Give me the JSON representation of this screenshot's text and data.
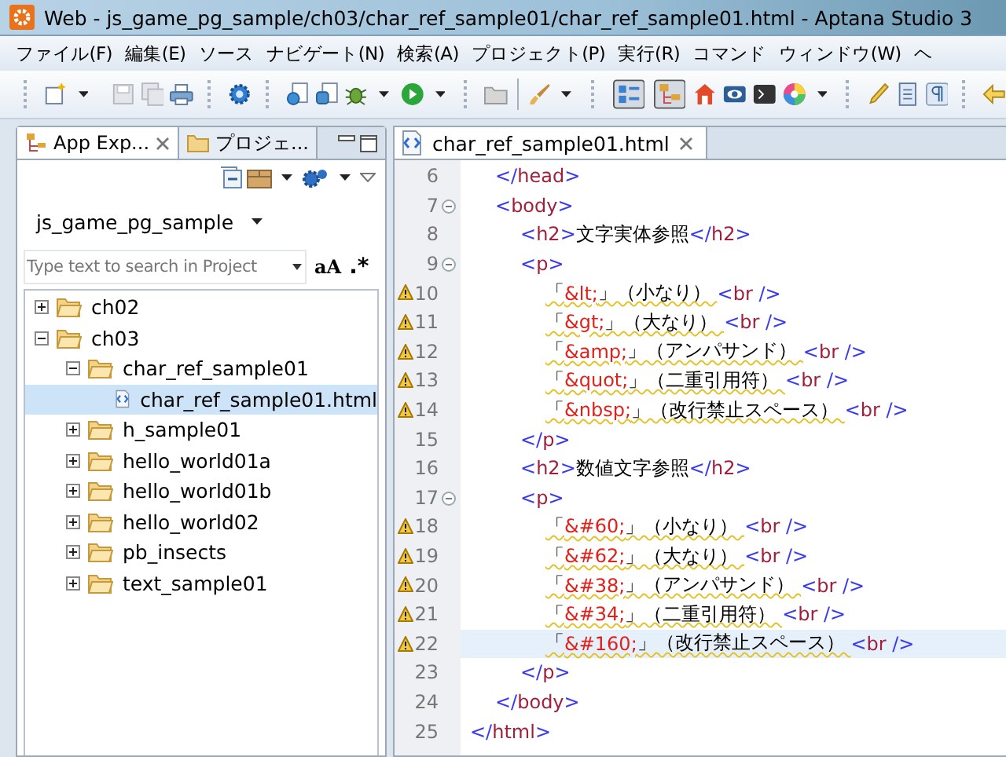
{
  "window": {
    "title": "Web - js_game_pg_sample/ch03/char_ref_sample01/char_ref_sample01.html - Aptana Studio 3"
  },
  "menu": [
    "ファイル(F)",
    "編集(E)",
    "ソース",
    "ナビゲート(N)",
    "検索(A)",
    "プロジェクト(P)",
    "実行(R)",
    "コマンド",
    "ウィンドウ(W)",
    "ヘ"
  ],
  "left_panel": {
    "tabs": [
      {
        "label": "App Exp...",
        "selected": true
      },
      {
        "label": "プロジェ...",
        "selected": false
      }
    ],
    "project": "js_game_pg_sample",
    "search": {
      "placeholder": "Type text to search in Project",
      "case_toggle": "aA",
      "regex_toggle": ".*"
    },
    "tree": [
      {
        "label": "ch02",
        "kind": "folder",
        "expanded": false,
        "selected": false
      },
      {
        "label": "ch03",
        "kind": "folder",
        "expanded": true,
        "selected": false,
        "children": [
          {
            "label": "char_ref_sample01",
            "kind": "folder",
            "expanded": true,
            "selected": false,
            "children": [
              {
                "label": "char_ref_sample01.html",
                "kind": "file",
                "selected": true
              }
            ]
          },
          {
            "label": "h_sample01",
            "kind": "folder",
            "expanded": false,
            "selected": false
          },
          {
            "label": "hello_world01a",
            "kind": "folder",
            "expanded": false,
            "selected": false
          },
          {
            "label": "hello_world01b",
            "kind": "folder",
            "expanded": false,
            "selected": false
          },
          {
            "label": "hello_world02",
            "kind": "folder",
            "expanded": false,
            "selected": false
          },
          {
            "label": "pb_insects",
            "kind": "folder",
            "expanded": false,
            "selected": false
          },
          {
            "label": "text_sample01",
            "kind": "folder",
            "expanded": false,
            "selected": false
          }
        ]
      }
    ]
  },
  "editor": {
    "tab": {
      "label": "char_ref_sample01.html",
      "selected": true
    },
    "lines": [
      {
        "children": [
          {
            "n": "6",
            "warning": false,
            "foldable": false,
            "current": false,
            "tokens": [
              {
                "kind": "punct",
                "text": "</"
              },
              {
                "kind": "tag",
                "text": "head"
              },
              {
                "kind": "punct",
                "text": ">"
              }
            ]
          },
          {
            "n": "7",
            "warning": false,
            "foldable": true,
            "current": false,
            "tokens": [
              {
                "kind": "punct",
                "text": "<"
              },
              {
                "kind": "tag",
                "text": "body"
              },
              {
                "kind": "punct",
                "text": ">"
              }
            ],
            "children": [
              {
                "n": "8",
                "warning": false,
                "foldable": false,
                "current": false,
                "tokens": [
                  {
                    "kind": "punct",
                    "text": "<"
                  },
                  {
                    "kind": "tag",
                    "text": "h2"
                  },
                  {
                    "kind": "punct",
                    "text": ">"
                  },
                  {
                    "kind": "plain",
                    "text": "文字実体参照"
                  },
                  {
                    "kind": "punct",
                    "text": "</"
                  },
                  {
                    "kind": "tag",
                    "text": "h2"
                  },
                  {
                    "kind": "punct",
                    "text": ">"
                  }
                ]
              },
              {
                "n": "9",
                "warning": false,
                "foldable": true,
                "current": false,
                "tokens": [
                  {
                    "kind": "punct",
                    "text": "<"
                  },
                  {
                    "kind": "tag",
                    "text": "p"
                  },
                  {
                    "kind": "punct",
                    "text": ">"
                  }
                ],
                "children": [
                  {
                    "n": "10",
                    "warning": true,
                    "foldable": false,
                    "current": false,
                    "tokens": [
                      {
                        "kind": "plain",
                        "text": "「"
                      },
                      {
                        "kind": "entity",
                        "text": "&lt;"
                      },
                      {
                        "kind": "plain",
                        "text": "」（小なり） "
                      },
                      {
                        "kind": "punct",
                        "text": "<"
                      },
                      {
                        "kind": "tag",
                        "text": "br"
                      },
                      {
                        "kind": "punct",
                        "text": " />"
                      }
                    ]
                  },
                  {
                    "n": "11",
                    "warning": true,
                    "foldable": false,
                    "current": false,
                    "tokens": [
                      {
                        "kind": "plain",
                        "text": "「"
                      },
                      {
                        "kind": "entity",
                        "text": "&gt;"
                      },
                      {
                        "kind": "plain",
                        "text": "」（大なり） "
                      },
                      {
                        "kind": "punct",
                        "text": "<"
                      },
                      {
                        "kind": "tag",
                        "text": "br"
                      },
                      {
                        "kind": "punct",
                        "text": " />"
                      }
                    ]
                  },
                  {
                    "n": "12",
                    "warning": true,
                    "foldable": false,
                    "current": false,
                    "tokens": [
                      {
                        "kind": "plain",
                        "text": "「"
                      },
                      {
                        "kind": "entity",
                        "text": "&amp;"
                      },
                      {
                        "kind": "plain",
                        "text": "」（アンパサンド） "
                      },
                      {
                        "kind": "punct",
                        "text": "<"
                      },
                      {
                        "kind": "tag",
                        "text": "br"
                      },
                      {
                        "kind": "punct",
                        "text": " />"
                      }
                    ]
                  },
                  {
                    "n": "13",
                    "warning": true,
                    "foldable": false,
                    "current": false,
                    "tokens": [
                      {
                        "kind": "plain",
                        "text": "「"
                      },
                      {
                        "kind": "entity",
                        "text": "&quot;"
                      },
                      {
                        "kind": "plain",
                        "text": "」（二重引用符） "
                      },
                      {
                        "kind": "punct",
                        "text": "<"
                      },
                      {
                        "kind": "tag",
                        "text": "br"
                      },
                      {
                        "kind": "punct",
                        "text": " />"
                      }
                    ]
                  },
                  {
                    "n": "14",
                    "warning": true,
                    "foldable": false,
                    "current": false,
                    "tokens": [
                      {
                        "kind": "plain",
                        "text": "「"
                      },
                      {
                        "kind": "entity",
                        "text": "&nbsp;"
                      },
                      {
                        "kind": "plain",
                        "text": "」（改行禁止スペース） "
                      },
                      {
                        "kind": "punct",
                        "text": "<"
                      },
                      {
                        "kind": "tag",
                        "text": "br"
                      },
                      {
                        "kind": "punct",
                        "text": " />"
                      }
                    ]
                  }
                ]
              },
              {
                "n": "15",
                "warning": false,
                "foldable": false,
                "current": false,
                "tokens": [
                  {
                    "kind": "punct",
                    "text": "</"
                  },
                  {
                    "kind": "tag",
                    "text": "p"
                  },
                  {
                    "kind": "punct",
                    "text": ">"
                  }
                ]
              },
              {
                "n": "16",
                "warning": false,
                "foldable": false,
                "current": false,
                "tokens": [
                  {
                    "kind": "punct",
                    "text": "<"
                  },
                  {
                    "kind": "tag",
                    "text": "h2"
                  },
                  {
                    "kind": "punct",
                    "text": ">"
                  },
                  {
                    "kind": "plain",
                    "text": "数値文字参照"
                  },
                  {
                    "kind": "punct",
                    "text": "</"
                  },
                  {
                    "kind": "tag",
                    "text": "h2"
                  },
                  {
                    "kind": "punct",
                    "text": ">"
                  }
                ]
              },
              {
                "n": "17",
                "warning": false,
                "foldable": true,
                "current": false,
                "tokens": [
                  {
                    "kind": "punct",
                    "text": "<"
                  },
                  {
                    "kind": "tag",
                    "text": "p"
                  },
                  {
                    "kind": "punct",
                    "text": ">"
                  }
                ],
                "children": [
                  {
                    "n": "18",
                    "warning": true,
                    "foldable": false,
                    "current": false,
                    "tokens": [
                      {
                        "kind": "plain",
                        "text": "「"
                      },
                      {
                        "kind": "entity",
                        "text": "&#60;"
                      },
                      {
                        "kind": "plain",
                        "text": "」（小なり） "
                      },
                      {
                        "kind": "punct",
                        "text": "<"
                      },
                      {
                        "kind": "tag",
                        "text": "br"
                      },
                      {
                        "kind": "punct",
                        "text": " />"
                      }
                    ]
                  },
                  {
                    "n": "19",
                    "warning": true,
                    "foldable": false,
                    "current": false,
                    "tokens": [
                      {
                        "kind": "plain",
                        "text": "「"
                      },
                      {
                        "kind": "entity",
                        "text": "&#62;"
                      },
                      {
                        "kind": "plain",
                        "text": "」（大なり） "
                      },
                      {
                        "kind": "punct",
                        "text": "<"
                      },
                      {
                        "kind": "tag",
                        "text": "br"
                      },
                      {
                        "kind": "punct",
                        "text": " />"
                      }
                    ]
                  },
                  {
                    "n": "20",
                    "warning": true,
                    "foldable": false,
                    "current": false,
                    "tokens": [
                      {
                        "kind": "plain",
                        "text": "「"
                      },
                      {
                        "kind": "entity",
                        "text": "&#38;"
                      },
                      {
                        "kind": "plain",
                        "text": "」（アンパサンド） "
                      },
                      {
                        "kind": "punct",
                        "text": "<"
                      },
                      {
                        "kind": "tag",
                        "text": "br"
                      },
                      {
                        "kind": "punct",
                        "text": " />"
                      }
                    ]
                  },
                  {
                    "n": "21",
                    "warning": true,
                    "foldable": false,
                    "current": false,
                    "tokens": [
                      {
                        "kind": "plain",
                        "text": "「"
                      },
                      {
                        "kind": "entity",
                        "text": "&#34;"
                      },
                      {
                        "kind": "plain",
                        "text": "」（二重引用符） "
                      },
                      {
                        "kind": "punct",
                        "text": "<"
                      },
                      {
                        "kind": "tag",
                        "text": "br"
                      },
                      {
                        "kind": "punct",
                        "text": " />"
                      }
                    ]
                  },
                  {
                    "n": "22",
                    "warning": true,
                    "foldable": false,
                    "current": true,
                    "tokens": [
                      {
                        "kind": "plain",
                        "text": "「"
                      },
                      {
                        "kind": "entity",
                        "text": "&#160;"
                      },
                      {
                        "kind": "plain",
                        "text": "」（改行禁止スペース） "
                      },
                      {
                        "kind": "punct",
                        "text": "<"
                      },
                      {
                        "kind": "tag",
                        "text": "br"
                      },
                      {
                        "kind": "punct",
                        "text": " />"
                      }
                    ]
                  }
                ]
              },
              {
                "n": "23",
                "warning": false,
                "foldable": false,
                "current": false,
                "tokens": [
                  {
                    "kind": "punct",
                    "text": "</"
                  },
                  {
                    "kind": "tag",
                    "text": "p"
                  },
                  {
                    "kind": "punct",
                    "text": ">"
                  }
                ]
              }
            ]
          },
          {
            "n": "24",
            "warning": false,
            "foldable": false,
            "current": false,
            "tokens": [
              {
                "kind": "punct",
                "text": "</"
              },
              {
                "kind": "tag",
                "text": "body"
              },
              {
                "kind": "punct",
                "text": ">"
              }
            ]
          }
        ]
      },
      {
        "n": "25",
        "warning": false,
        "foldable": false,
        "current": false,
        "tokens": [
          {
            "kind": "punct",
            "text": "</"
          },
          {
            "kind": "tag",
            "text": "html"
          },
          {
            "kind": "punct",
            "text": ">"
          }
        ]
      }
    ]
  }
}
